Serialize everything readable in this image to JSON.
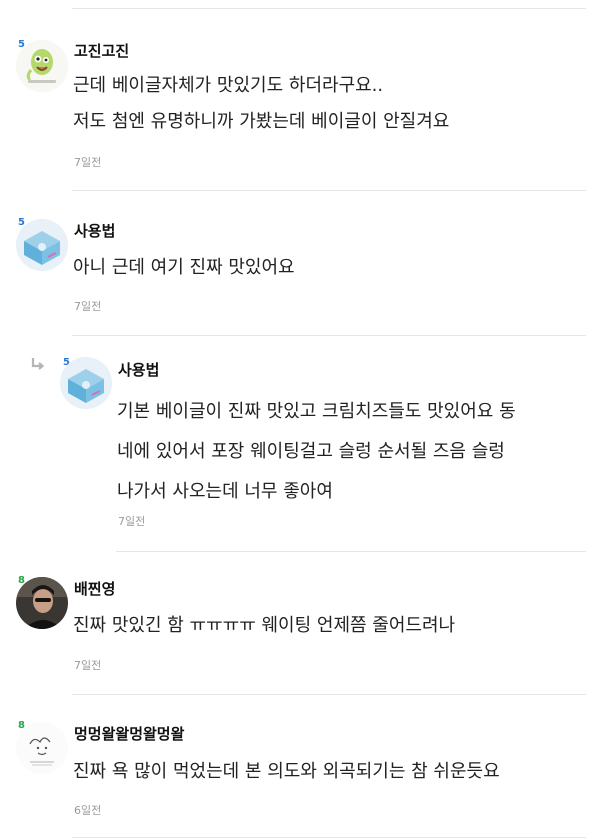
{
  "comments": [
    {
      "level": "5",
      "author": "고진고진",
      "lines": [
        "근데 베이글자체가 맛있기도 하더라구요..",
        "저도 첨엔 유명하니까 가봤는데 베이글이 안질겨요"
      ],
      "date": "7일전",
      "avatar_icon": "green-cartoon-character-icon"
    },
    {
      "level": "5",
      "author": "사용법",
      "lines": [
        "아니 근데 여기 진짜 맛있어요"
      ],
      "date": "7일전",
      "avatar_icon": "blue-box-illustration-icon"
    },
    {
      "level": "5",
      "author": "사용법",
      "is_reply": true,
      "lines": [
        "기본 베이글이 진짜 맛있고 크림치즈들도 맛있어요 동",
        "네에 있어서 포장 웨이팅걸고 슬렁 순서될 즈음 슬렁",
        "나가서 사오는데 너무 좋아여"
      ],
      "date": "7일전",
      "avatar_icon": "blue-box-illustration-icon"
    },
    {
      "level": "8",
      "author": "배찐영",
      "lines": [
        "진짜 맛있긴 함 ㅠㅠㅠㅠ 웨이팅 언제쯤 줄어드려나"
      ],
      "date": "7일전",
      "avatar_icon": "person-photo-icon"
    },
    {
      "level": "8",
      "author": "멍멍왈왈멍왈멍왈",
      "lines": [
        "진짜 욕 많이 먹었는데 본 의도와 외곡되기는 참 쉬운듯요"
      ],
      "date": "6일전",
      "avatar_icon": "sketch-drawing-icon"
    }
  ],
  "colors": {
    "level_blue": "#2b7bd6",
    "level_green": "#27a54a",
    "date_gray": "#9a9a9a",
    "separator": "#e6e6e6"
  }
}
